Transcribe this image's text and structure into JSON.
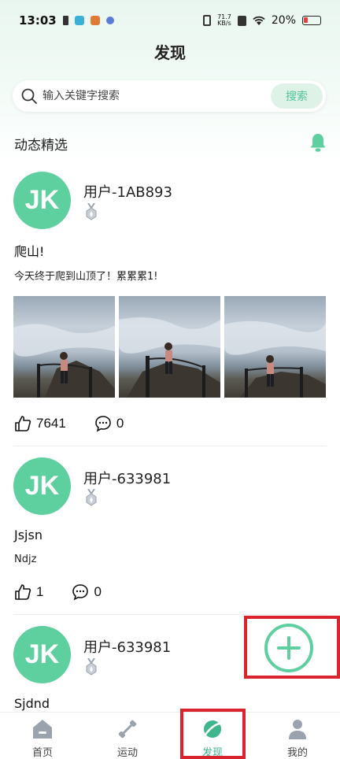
{
  "status_bar": {
    "time": "13:03",
    "net_speed_value": "71.7",
    "net_speed_unit": "KB/s",
    "battery": "20%"
  },
  "header": {
    "title": "发现"
  },
  "search": {
    "placeholder": "输入关键字搜索",
    "button_label": "搜索"
  },
  "section": {
    "title": "动态精选"
  },
  "posts": [
    {
      "avatar_text": "JK",
      "username": "用户-1AB893",
      "title": "爬山!",
      "content": "今天终于爬到山顶了！累累累1!",
      "likes": "7641",
      "comments": "0"
    },
    {
      "avatar_text": "JK",
      "username": "用户-633981",
      "title": "Jsjsn",
      "content": "Ndjz",
      "likes": "1",
      "comments": "0"
    },
    {
      "avatar_text": "JK",
      "username": "用户-633981",
      "title": "Sjdnd"
    }
  ],
  "tabbar": {
    "items": [
      {
        "label": "首页",
        "icon": "home-icon"
      },
      {
        "label": "运动",
        "icon": "dumbbell-icon"
      },
      {
        "label": "发现",
        "icon": "planet-icon"
      },
      {
        "label": "我的",
        "icon": "person-icon"
      }
    ],
    "active_index": 2
  },
  "colors": {
    "accent": "#5ecf9f",
    "highlight": "#d9232d"
  }
}
